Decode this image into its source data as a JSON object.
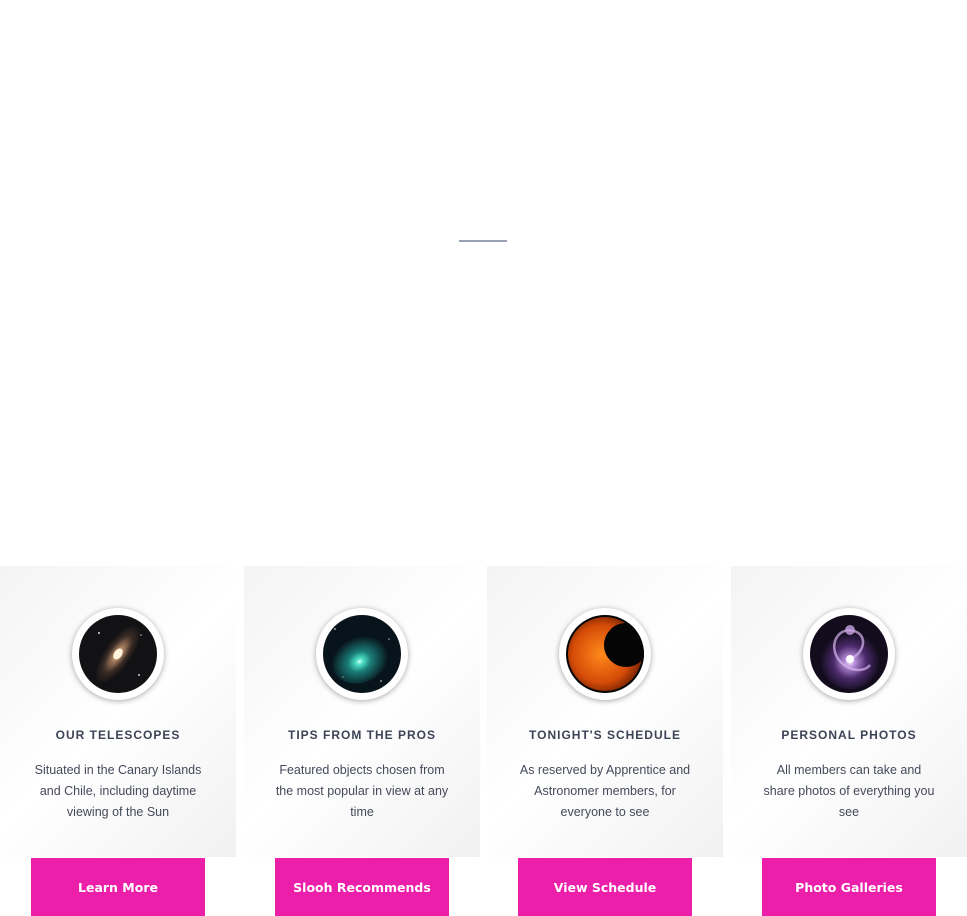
{
  "features": [
    {
      "title": "OUR TELESCOPES",
      "description": "Situated in the Canary Islands and Chile, including daytime viewing of the Sun",
      "button_label": "Learn More",
      "icon": "galaxy-andromeda-icon"
    },
    {
      "title": "TIPS FROM THE PROS",
      "description": "Featured objects chosen from the most popular in view at any time",
      "button_label": "Slooh Recommends",
      "icon": "comet-icon"
    },
    {
      "title": "TONIGHT'S SCHEDULE",
      "description": "As reserved by Apprentice and Astronomer members, for everyone to see",
      "button_label": "View Schedule",
      "icon": "solar-eclipse-icon"
    },
    {
      "title": "PERSONAL PHOTOS",
      "description": "All members can take and share photos of everything you see",
      "button_label": "Photo Galleries",
      "icon": "spiral-galaxy-icon"
    }
  ],
  "colors": {
    "accent": "#ec1fab",
    "title_text": "#3d4356",
    "body_text": "#454a5a",
    "divider": "#9aa2b5"
  }
}
